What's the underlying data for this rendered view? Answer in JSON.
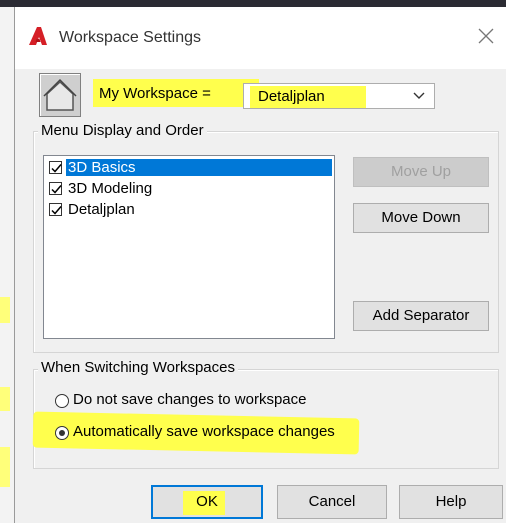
{
  "dialog": {
    "title": "Workspace Settings",
    "app_icon": "autocad-logo-icon",
    "close_icon": "close-icon"
  },
  "workspace": {
    "label": "My Workspace =",
    "selected": "Detaljplan",
    "icon": "house-icon"
  },
  "menu_display": {
    "group_title": "Menu Display and Order",
    "items": [
      {
        "label": "3D Basics",
        "checked": true,
        "selected": true
      },
      {
        "label": "3D Modeling",
        "checked": true,
        "selected": false
      },
      {
        "label": "Detaljplan",
        "checked": true,
        "selected": false
      }
    ],
    "buttons": {
      "move_up": "Move Up",
      "move_down": "Move Down",
      "add_separator": "Add Separator"
    }
  },
  "switching": {
    "group_title": "When Switching Workspaces",
    "options": [
      {
        "label": "Do not save changes to workspace",
        "selected": false
      },
      {
        "label": "Automatically save workspace changes",
        "selected": true
      }
    ]
  },
  "footer": {
    "ok": "OK",
    "cancel": "Cancel",
    "help": "Help"
  },
  "colors": {
    "highlight": "#ffff4d",
    "selection": "#0078d7",
    "brand_red": "#d51f26"
  }
}
